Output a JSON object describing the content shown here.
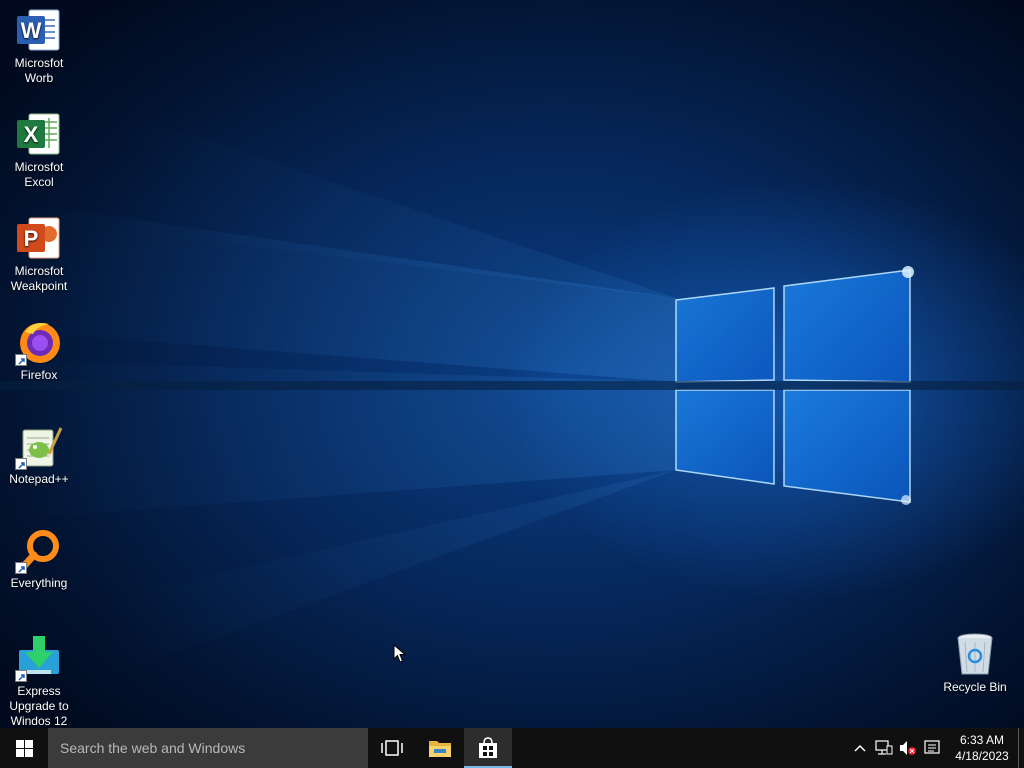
{
  "desktop": {
    "icons": [
      {
        "label": "Microsfot\nWorb",
        "icon": "word-icon"
      },
      {
        "label": "Microsfot\nExcol",
        "icon": "excel-icon"
      },
      {
        "label": "Microsfot\nWeakpoint",
        "icon": "powerpoint-icon"
      },
      {
        "label": "Firefox",
        "icon": "firefox-icon"
      },
      {
        "label": "Notepad++",
        "icon": "notepadpp-icon"
      },
      {
        "label": "Everything",
        "icon": "everything-search-icon"
      },
      {
        "label": "Express\nUpgrade to\nWindos 12",
        "icon": "download-arrow-icon"
      }
    ],
    "recycle_bin": {
      "label": "Recycle Bin",
      "icon": "recycle-bin-icon"
    }
  },
  "taskbar": {
    "start_icon": "windows-logo-icon",
    "search_placeholder": "Search the web and Windows",
    "buttons": [
      {
        "name": "Task View",
        "icon": "task-view-icon"
      },
      {
        "name": "File Explorer",
        "icon": "folder-icon"
      },
      {
        "name": "Store",
        "icon": "store-bag-icon"
      }
    ],
    "tray": {
      "icons": [
        "chevron-up-icon",
        "network-icon",
        "volume-muted-icon",
        "action-center-icon"
      ],
      "time": "6:33 AM",
      "date": "4/18/2023"
    }
  },
  "colors": {
    "taskbar": "#101010",
    "search_box": "#3b3b3b",
    "accent": "#76b9ed",
    "wallpaper_glow": "#1e78e6"
  }
}
